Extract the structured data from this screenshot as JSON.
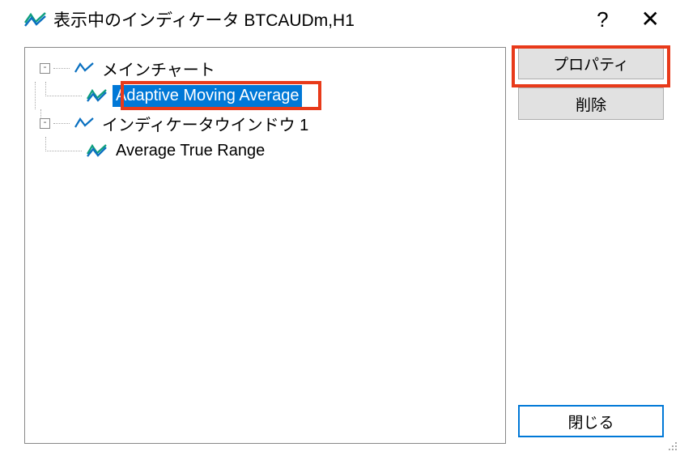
{
  "titlebar": {
    "title": "表示中のインディケータ BTCAUDm,H1",
    "help": "?",
    "close": "✕"
  },
  "tree": {
    "node1": {
      "label": "メインチャート",
      "toggle": "-"
    },
    "node1_child": {
      "label": "Adaptive Moving Average"
    },
    "node2": {
      "label": "インディケータウインドウ 1",
      "toggle": "-"
    },
    "node2_child": {
      "label": "Average True Range"
    }
  },
  "buttons": {
    "properties": "プロパティ",
    "delete": "削除",
    "close": "閉じる"
  }
}
